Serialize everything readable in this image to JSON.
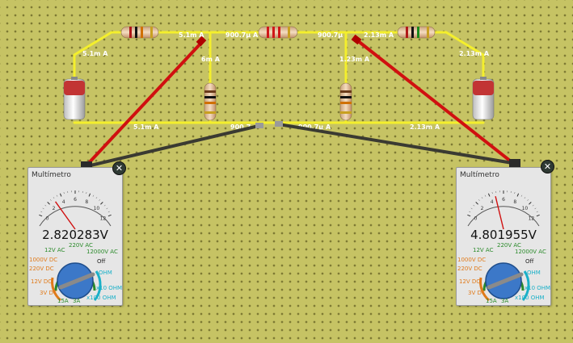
{
  "wire_currents": {
    "top_left": "5.1m A",
    "top_mid_left": "5.1m A",
    "top_mid": "900.7μ A",
    "top_mid_right": "900.7μ",
    "top_right_inner": "2.13m A",
    "top_right_outer": "2.13m A",
    "branch_left": "6m A",
    "branch_right": "1.23m A",
    "bottom_left": "5.1m A",
    "bottom_mid_left": "900.7",
    "bottom_mid_right": "900.7μ A",
    "bottom_right": "2.13m A"
  },
  "multimeters": [
    {
      "title": "Multímetro",
      "reading": "2.820283V",
      "needle_fraction": 0.24,
      "scale_ticks": [
        "0",
        "2",
        "4",
        "6",
        "8",
        "10",
        "12"
      ],
      "dial": {
        "ac": [
          "12V AC",
          "220V AC",
          "12000V AC"
        ],
        "dc": [
          "1000V DC",
          "220V DC",
          "12V DC",
          "3V DC"
        ],
        "ohm": [
          "Off",
          "OHM",
          "x10 OHM",
          "x100 OHM"
        ],
        "amp": [
          "15A",
          "3A"
        ]
      }
    },
    {
      "title": "Multímetro",
      "reading": "4.801955V",
      "needle_fraction": 0.4,
      "scale_ticks": [
        "0",
        "2",
        "4",
        "6",
        "8",
        "10",
        "12"
      ],
      "dial": {
        "ac": [
          "12V AC",
          "220V AC",
          "12000V AC"
        ],
        "dc": [
          "1000V DC",
          "220V DC",
          "12V DC",
          "3V DC"
        ],
        "ohm": [
          "Off",
          "OHM",
          "x10 OHM",
          "x100 OHM"
        ],
        "amp": [
          "15A",
          "3A"
        ]
      }
    }
  ],
  "colors": {
    "board": "#c6c364",
    "wire": "#f4ef2c",
    "probe_positive": "#d01010",
    "probe_negative": "#3a3a32",
    "dial_knob": "#3c78c8",
    "ac_labels": "#2a8a2a",
    "dc_labels": "#e07a1a",
    "ohm_labels": "#1ab0c8"
  },
  "close_label": "✕"
}
